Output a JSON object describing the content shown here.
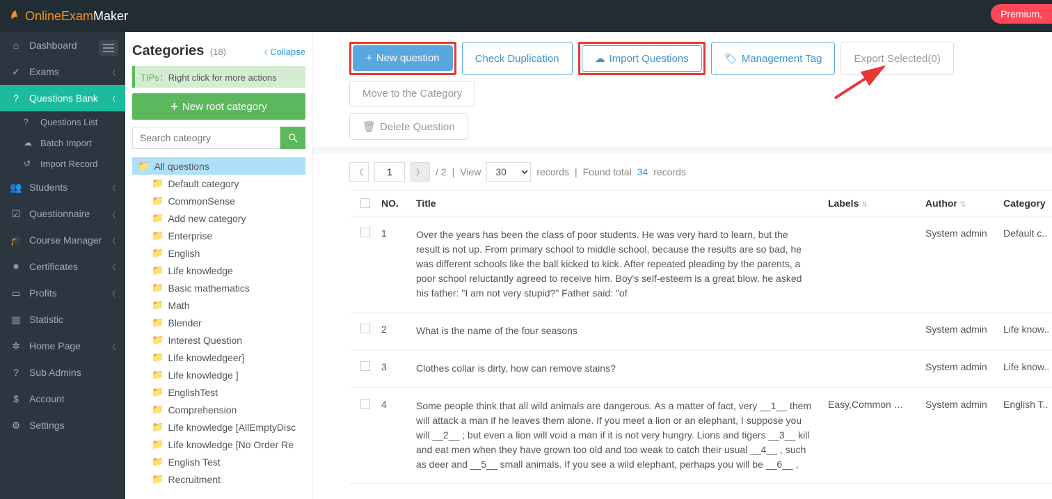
{
  "brand": {
    "part1": "OnlineExam",
    "part2": "Maker"
  },
  "premium_label": "Premium,",
  "sidebar": {
    "items": [
      {
        "label": "Dashboard",
        "icon": "home"
      },
      {
        "label": "Exams",
        "icon": "check",
        "chev": true
      },
      {
        "label": "Questions Bank",
        "icon": "help",
        "chev": true,
        "active": true
      },
      {
        "label": "Students",
        "icon": "users",
        "chev": true
      },
      {
        "label": "Questionnaire",
        "icon": "clipboard",
        "chev": true
      },
      {
        "label": "Course Manager",
        "icon": "grad",
        "chev": true
      },
      {
        "label": "Certificates",
        "icon": "cert",
        "chev": true
      },
      {
        "label": "Profits",
        "icon": "card",
        "chev": true
      },
      {
        "label": "Statistic",
        "icon": "stats"
      },
      {
        "label": "Home Page",
        "icon": "gear",
        "chev": true
      },
      {
        "label": "Sub Admins",
        "icon": "help2"
      },
      {
        "label": "Account",
        "icon": "dollar"
      },
      {
        "label": "Settings",
        "icon": "cog"
      }
    ],
    "sub": [
      {
        "label": "Questions List",
        "icon": "q"
      },
      {
        "label": "Batch Import",
        "icon": "cloud"
      },
      {
        "label": "Import Record",
        "icon": "history"
      }
    ]
  },
  "categories": {
    "title": "Categories",
    "count": "(18)",
    "collapse": "Collapse",
    "tips_prefix": "TIPs：",
    "tips_text": "Right click for more actions",
    "new_root": "New root category",
    "search_placeholder": "Search cateogry",
    "nodes": [
      "All questions",
      "Default category",
      "CommonSense",
      "Add new category",
      "Enterprise",
      "English",
      "Life knowledge",
      "Basic mathematics",
      "Math",
      "Blender",
      "Interest Question",
      "Life knowledgeer]",
      "Life knowledge ]",
      "EnglishTest",
      "Comprehension",
      "Life knowledge [AllEmptyDisc",
      "Life knowledge [No Order Re",
      "English Test",
      "Recruitment"
    ]
  },
  "toolbar": {
    "new_question": "New question",
    "check_dup": "Check Duplication",
    "import_q": "Import Questions",
    "manage_tag": "Management Tag",
    "export_sel": "Export Selected(0)",
    "move_cat": "Move to the Category",
    "delete_q": "Delete Question"
  },
  "pager": {
    "page": "1",
    "total_pages": "/ 2",
    "sep": "|",
    "view": "View",
    "per_page": "30",
    "records": "records",
    "found_prefix": "Found total",
    "found_num": "34",
    "found_suffix": "records"
  },
  "table": {
    "headers": {
      "no": "NO.",
      "title": "Title",
      "labels": "Labels",
      "author": "Author",
      "category": "Category"
    },
    "rows": [
      {
        "no": "1",
        "title": "Over the years has been the class of poor students. He was very hard to learn, but the result is not up. From primary school to middle school, because the results are so bad, he was different schools like the ball kicked to kick. After repeated pleading by the parents, a poor school reluctantly agreed to receive him.\nBoy's self-esteem is a great blow, he asked his father: \"I am not very stupid?\" Father said: \"of",
        "labels": "",
        "author": "System admin",
        "category": "Default c.."
      },
      {
        "no": "2",
        "title": "What is the name of the four seasons",
        "labels": "",
        "author": "System admin",
        "category": "Life know.."
      },
      {
        "no": "3",
        "title": "Clothes collar is dirty, how can remove stains?",
        "labels": "",
        "author": "System admin",
        "category": "Life know.."
      },
      {
        "no": "4",
        "title": "Some people think that all wild animals are dangerous. As a matter of fact, very __1__ them will attack a man if he leaves them alone. If you meet a lion or an elephant, I suppose you will __2__ ; but even a lion will void a man if it is not very hungry. Lions and tigers __3__ kill and eat men when they have grown too old and too weak to catch their usual __4__ , such as deer and __5__ small animals. If you see a wild elephant, perhaps you will be __6__ ,",
        "labels": "Easy,Common …",
        "author": "System admin",
        "category": "English T.."
      }
    ]
  }
}
